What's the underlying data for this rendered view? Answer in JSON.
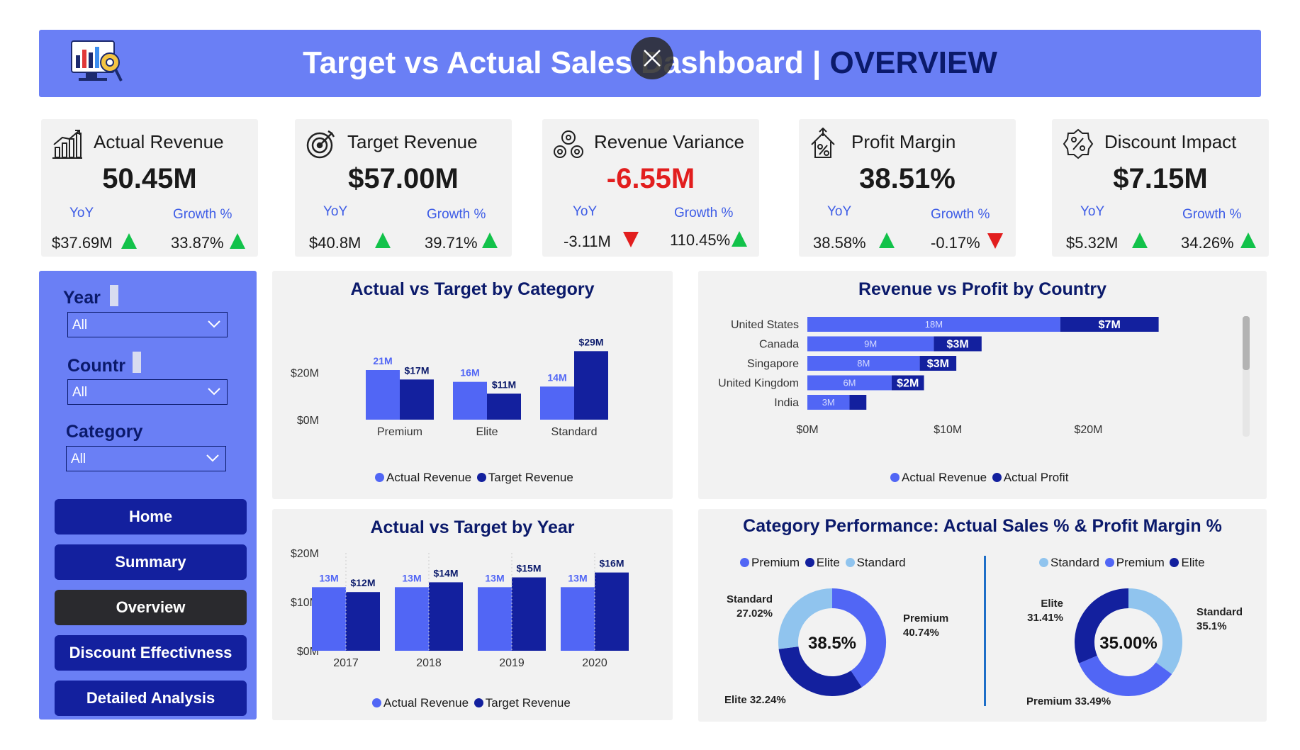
{
  "header": {
    "title_main": "Target vs Actual Sales Dashboard | ",
    "title_accent": "OVERVIEW"
  },
  "colors": {
    "header_bg": "#6a7ff5",
    "actual": "#5166f5",
    "target": "#13209e",
    "light": "#90c4ee",
    "positive": "#12c24a",
    "negative": "#e21e1e"
  },
  "kpis": [
    {
      "title": "Actual Revenue",
      "value": "50.45M",
      "yoy_label": "YoY",
      "growth_label": "Growth %",
      "yoy": "$37.69M",
      "growth": "33.87%",
      "icon": "bar-growth-icon"
    },
    {
      "title": "Target Revenue",
      "value": "$57.00M",
      "yoy_label": "YoY",
      "growth_label": "Growth %",
      "yoy": "$40.8M",
      "growth": "39.71%",
      "icon": "target-icon"
    },
    {
      "title": "Revenue Variance",
      "value": "-6.55M",
      "yoy_label": "YoY",
      "growth_label": "Growth %",
      "yoy": "-3.11M",
      "growth": "110.45%",
      "icon": "gears-icon"
    },
    {
      "title": "Profit Margin",
      "value": "38.51%",
      "yoy_label": "YoY",
      "growth_label": "Growth %",
      "yoy": "38.58%",
      "growth": "-0.17%",
      "icon": "percent-house-icon"
    },
    {
      "title": "Discount Impact",
      "value": "$7.15M",
      "yoy_label": "YoY",
      "growth_label": "Growth %",
      "yoy": "$5.32M",
      "growth": "34.26%",
      "icon": "discount-badge-icon"
    }
  ],
  "filters": {
    "year": {
      "label": "Year",
      "value": "All"
    },
    "country": {
      "label": "Countr",
      "value": "All"
    },
    "category": {
      "label": "Category",
      "value": "All"
    }
  },
  "nav": {
    "home": "Home",
    "summary": "Summary",
    "overview": "Overview",
    "discount": "Discount Effectivness",
    "detailed": "Detailed Analysis"
  },
  "chart_data": [
    {
      "id": "category",
      "type": "bar",
      "title": "Actual vs Target by Category",
      "categories": [
        "Premium",
        "Elite",
        "Standard"
      ],
      "series": [
        {
          "name": "Actual Revenue",
          "values": [
            21,
            16,
            14
          ],
          "labels": [
            "21M",
            "16M",
            "14M"
          ]
        },
        {
          "name": "Target Revenue",
          "values": [
            17,
            11,
            29
          ],
          "labels": [
            "$17M",
            "$11M",
            "$29M"
          ]
        }
      ],
      "y_ticks": [
        "$0M",
        "$20M"
      ],
      "ylim": [
        0,
        30
      ],
      "legend": "bottom"
    },
    {
      "id": "country",
      "type": "bar",
      "orientation": "horizontal",
      "stacked": true,
      "title": "Revenue vs Profit by Country",
      "categories": [
        "United States",
        "Canada",
        "Singapore",
        "United Kingdom",
        "India"
      ],
      "series": [
        {
          "name": "Actual Revenue",
          "values": [
            18,
            9,
            8,
            6,
            3
          ],
          "labels": [
            "18M",
            "9M",
            "8M",
            "6M",
            "3M"
          ]
        },
        {
          "name": "Actual Profit",
          "values": [
            7,
            3.4,
            2.6,
            2.3,
            1.2
          ],
          "labels": [
            "$7M",
            "$3M",
            "$3M",
            "$2M",
            ""
          ]
        }
      ],
      "x_ticks": [
        "$0M",
        "$10M",
        "$20M"
      ],
      "xlim": [
        0,
        25
      ],
      "legend": "bottom"
    },
    {
      "id": "year",
      "type": "bar",
      "title": "Actual vs Target  by Year",
      "categories": [
        "2017",
        "2018",
        "2019",
        "2020"
      ],
      "series": [
        {
          "name": "Actual Revenue",
          "values": [
            13,
            13,
            13,
            13
          ],
          "labels": [
            "13M",
            "13M",
            "13M",
            "13M"
          ]
        },
        {
          "name": "Target Revenue",
          "values": [
            12,
            14,
            15,
            16
          ],
          "labels": [
            "$12M",
            "$14M",
            "$15M",
            "$16M"
          ]
        }
      ],
      "y_ticks": [
        "$0M",
        "$10M",
        "$20M"
      ],
      "ylim": [
        0,
        20
      ],
      "legend": "bottom"
    },
    {
      "id": "sales-share",
      "type": "pie",
      "donut": true,
      "title": "Category Performance: Actual Sales % & Profit Margin %",
      "center": "38.5%",
      "legend": "top",
      "slices": [
        {
          "name": "Premium",
          "value": 40.74,
          "label": "Premium",
          "pct": "40.74%"
        },
        {
          "name": "Elite",
          "value": 32.24,
          "label": "Elite",
          "pct": "32.24%"
        },
        {
          "name": "Standard",
          "value": 27.02,
          "label": "Standard",
          "pct": "27.02%"
        }
      ]
    },
    {
      "id": "profit-share",
      "type": "pie",
      "donut": true,
      "center": "35.00%",
      "legend": "top",
      "slices": [
        {
          "name": "Standard",
          "value": 35.1,
          "label": "Standard",
          "pct": "35.1%"
        },
        {
          "name": "Premium",
          "value": 33.49,
          "label": "Premium",
          "pct": "33.49%"
        },
        {
          "name": "Elite",
          "value": 31.41,
          "label": "Elite",
          "pct": "31.41%"
        }
      ]
    }
  ]
}
